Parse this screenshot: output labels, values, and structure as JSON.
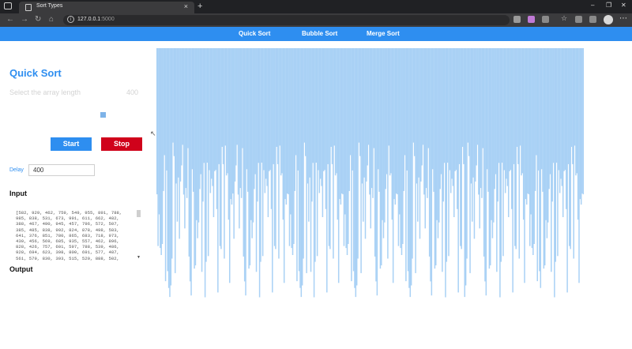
{
  "browser": {
    "tab_title": "Sort Types",
    "url_host": "127.0.0.1",
    "url_port": ":5000"
  },
  "nav": {
    "items": [
      "Quick Sort",
      "Bubble Sort",
      "Merge Sort"
    ]
  },
  "panel": {
    "title": "Quick Sort",
    "length_label": "Select the array length",
    "length_value": "400",
    "slider_value": 400,
    "start_label": "Start",
    "stop_label": "Stop",
    "delay_label": "Delay",
    "delay_value": "400",
    "input_label": "Input",
    "output_label": "Output",
    "input_lines": [
      "[582, 929, 462, 759, 549, 955, 891, 788,",
      "985, 838, 531, 673, 991, 611, 662, 482,",
      "388, 467, 490, 945, 457, 796, 572, 507,",
      "385, 485, 838, 992, 824, 878, 498, 583,",
      "641, 376, 851, 780, 865, 683, 718, 973,",
      "430, 456, 569, 685, 935, 557, 462, 896,",
      "828, 426, 757, 601, 597, 788, 539, 486,",
      "928, 694, 623, 398, 800, 691, 577, 487,",
      "561, 579, 830, 393, 515, 520, 888, 502,"
    ]
  },
  "colors": {
    "accent": "#2e8ef0",
    "stop": "#d0021b",
    "bar": "#a9d1f5"
  },
  "icons": {
    "back": "arrow-left-icon",
    "forward": "arrow-right-icon",
    "reload": "reload-icon",
    "home": "home-icon"
  },
  "chart_data": {
    "type": "bar",
    "ylim": [
      0,
      1000
    ],
    "values": [
      582,
      929,
      462,
      759,
      549,
      955,
      891,
      788,
      985,
      838,
      531,
      673,
      991,
      611,
      662,
      482,
      388,
      467,
      490,
      945,
      457,
      796,
      572,
      507,
      385,
      485,
      838,
      992,
      824,
      878,
      498,
      583,
      641,
      376,
      851,
      780,
      865,
      683,
      718,
      973,
      430,
      456,
      569,
      685,
      935,
      557,
      462,
      896,
      828,
      426,
      757,
      601,
      597,
      788,
      539,
      486,
      928,
      694,
      623,
      398,
      800,
      691,
      577,
      487,
      561,
      579,
      830,
      393,
      515,
      520,
      888,
      502
    ]
  }
}
